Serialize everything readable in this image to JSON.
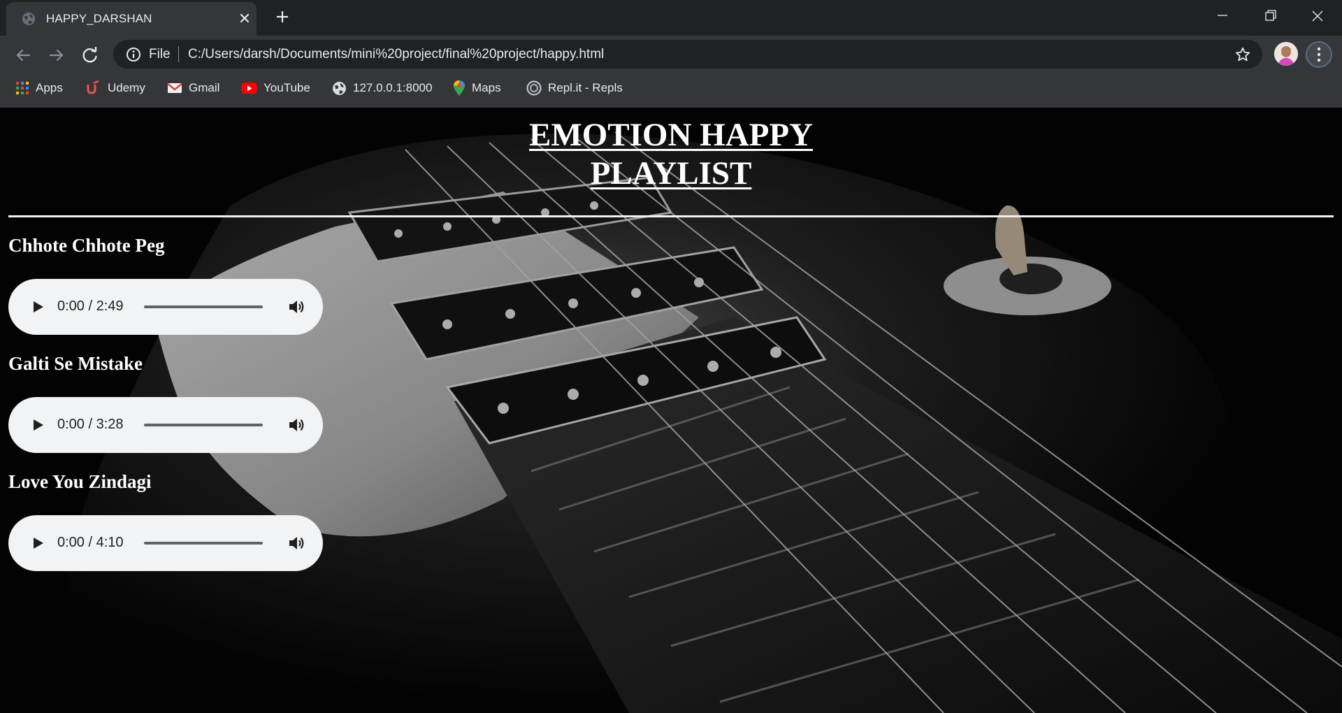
{
  "browser": {
    "tab_title": "HAPPY_DARSHAN",
    "address_scheme": "File",
    "address_url": "C:/Users/darsh/Documents/mini%20project/final%20project/happy.html",
    "bookmarks": [
      {
        "label": "Apps",
        "icon": "apps-grid-icon"
      },
      {
        "label": "Udemy",
        "icon": "udemy-icon"
      },
      {
        "label": "Gmail",
        "icon": "gmail-icon"
      },
      {
        "label": "YouTube",
        "icon": "youtube-icon"
      },
      {
        "label": "127.0.0.1:8000",
        "icon": "globe-icon"
      },
      {
        "label": "Maps",
        "icon": "maps-pin-icon"
      },
      {
        "label": "Repl.it - Repls",
        "icon": "replit-icon"
      }
    ]
  },
  "page": {
    "heading_line1": "EMOTION HAPPY",
    "heading_line2": "PLAYLIST",
    "songs": [
      {
        "title": "Chhote Chhote Peg",
        "time": "0:00 / 2:49",
        "progress": 0
      },
      {
        "title": "Galti Se Mistake",
        "time": "0:00 / 3:28",
        "progress": 0
      },
      {
        "title": "Love You Zindagi",
        "time": "0:00 / 4:10",
        "progress": 0
      }
    ]
  },
  "colors": {
    "chrome_dark": "#202124",
    "chrome_toolbar": "#35363a",
    "player_bg": "#f1f3f4",
    "page_bg": "#060606",
    "text_white": "#ffffff"
  }
}
